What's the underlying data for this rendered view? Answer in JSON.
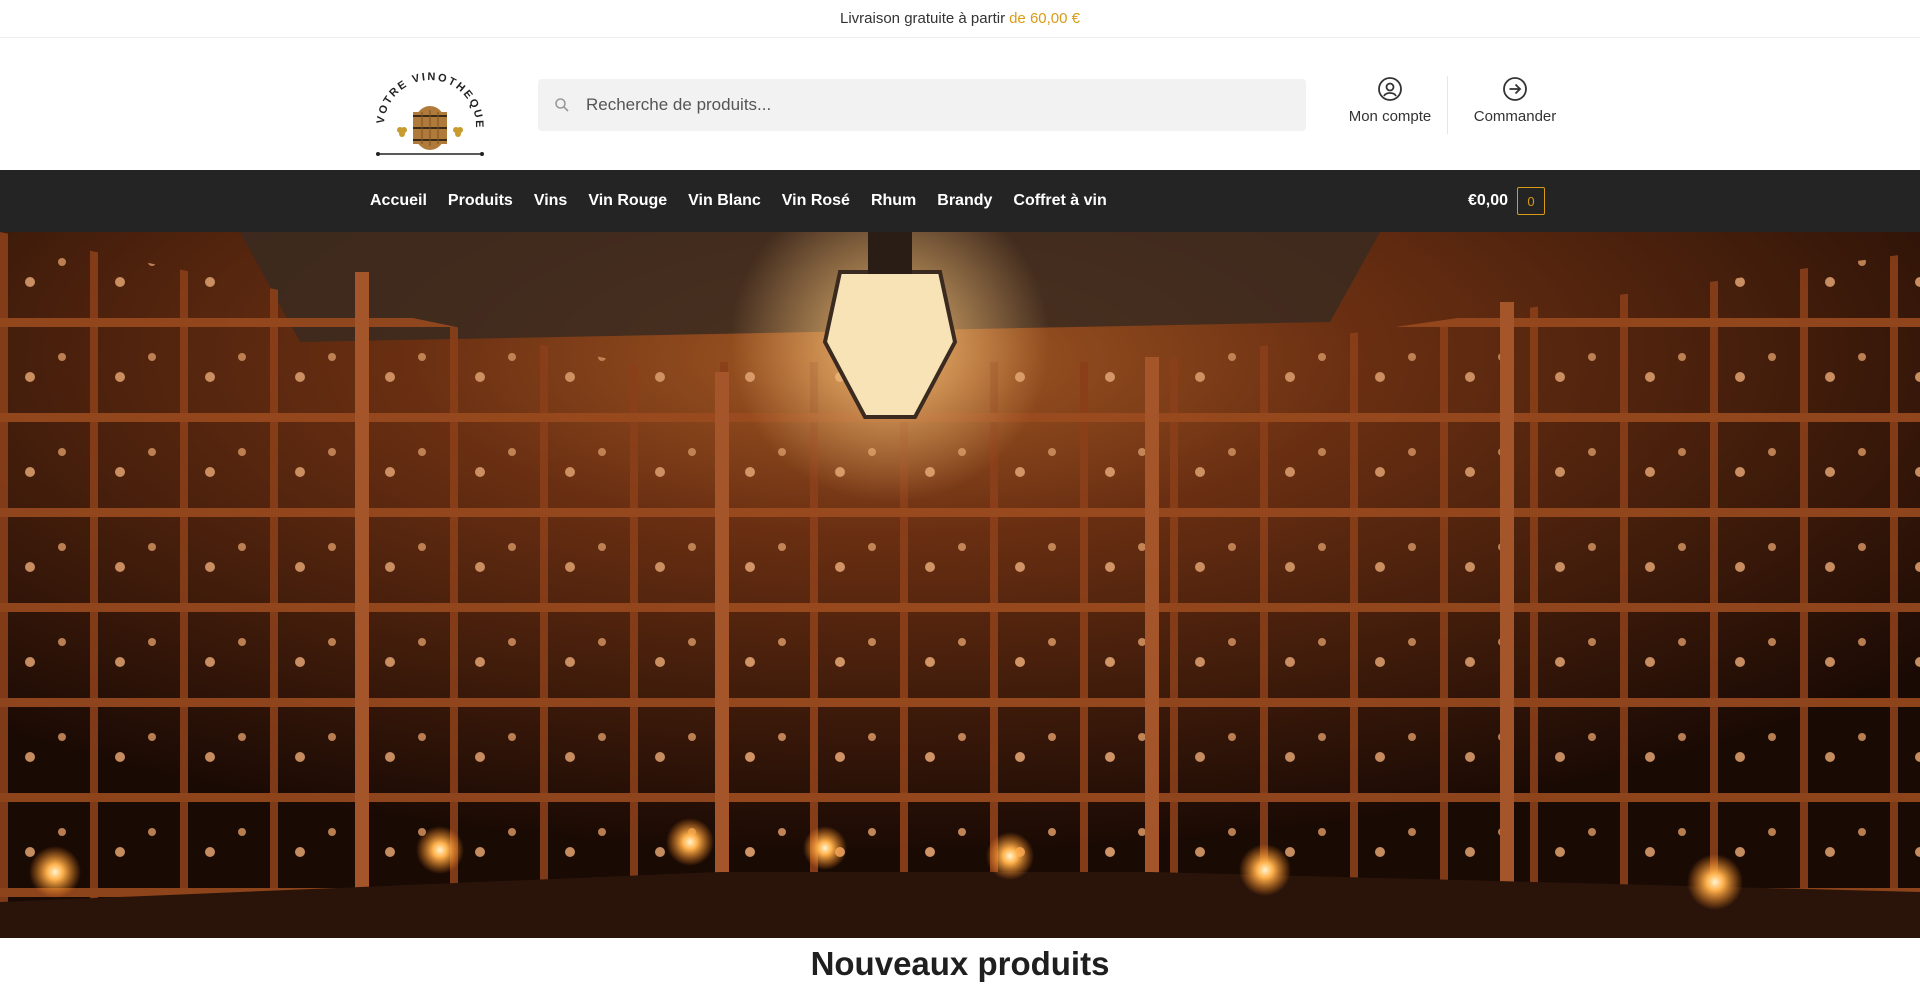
{
  "topbar": {
    "text": "Livraison gratuite à partir",
    "accent": "de 60,00 €"
  },
  "logo": {
    "text": "VOTRE VINOTHEQUE"
  },
  "search": {
    "placeholder": "Recherche de produits..."
  },
  "header": {
    "account_label": "Mon compte",
    "checkout_label": "Commander"
  },
  "nav": {
    "items": [
      "Accueil",
      "Produits",
      "Vins",
      "Vin Rouge",
      "Vin Blanc",
      "Vin Rosé",
      "Rhum",
      "Brandy",
      "Coffret à vin"
    ]
  },
  "cart": {
    "amount": "€0,00",
    "count": "0"
  },
  "hero": {
    "image": "wine-cellar-photo"
  },
  "section": {
    "title": "Nouveaux produits"
  },
  "colors": {
    "accent": "#d89b14",
    "nav_bg": "#242424"
  }
}
